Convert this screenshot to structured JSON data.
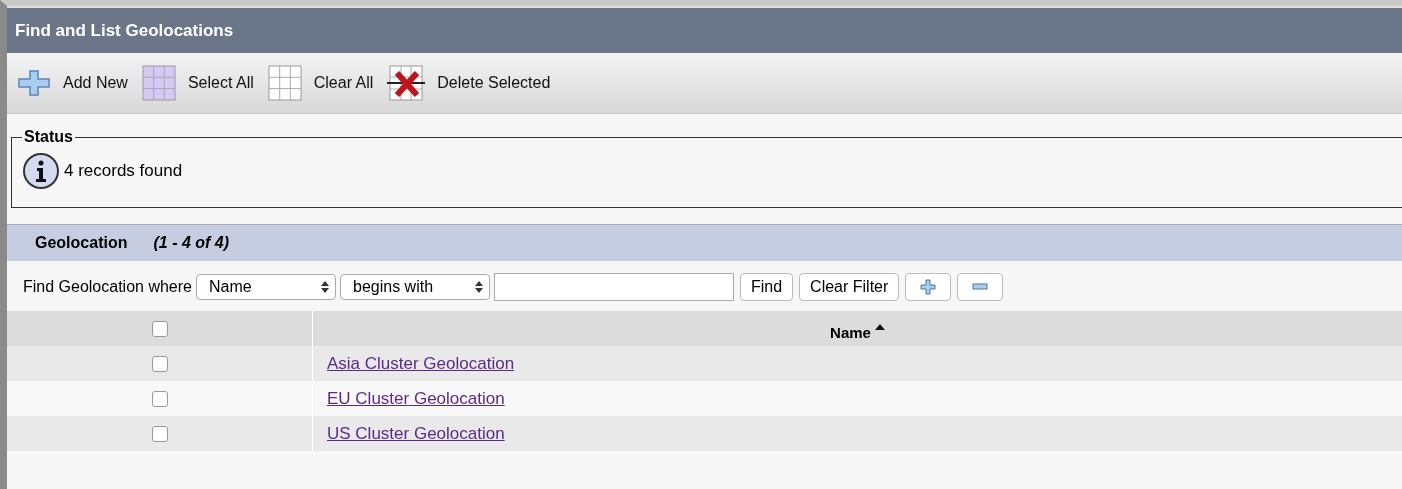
{
  "window": {
    "title": "Find and List Geolocations"
  },
  "toolbar": [
    {
      "kind": "add",
      "label": "Add New"
    },
    {
      "kind": "select_all",
      "label": "Select All"
    },
    {
      "kind": "clear_all",
      "label": "Clear All"
    },
    {
      "kind": "delete",
      "label": "Delete Selected"
    }
  ],
  "status": {
    "legend": "Status",
    "message": "4 records found"
  },
  "list": {
    "title": "Geolocation",
    "range": "(1 - 4 of 4)",
    "filter": {
      "label": "Find Geolocation where",
      "field": "Name",
      "operator": "begins with",
      "find_button": "Find",
      "clear_button": "Clear Filter"
    },
    "table": {
      "header_checked": false,
      "columns": [
        "Name"
      ],
      "rows": [
        {
          "name": "Asia Cluster Geolocation",
          "checked": false
        },
        {
          "name": "EU Cluster Geolocation",
          "checked": false
        },
        {
          "name": "US Cluster Geolocation",
          "checked": false
        }
      ]
    }
  }
}
